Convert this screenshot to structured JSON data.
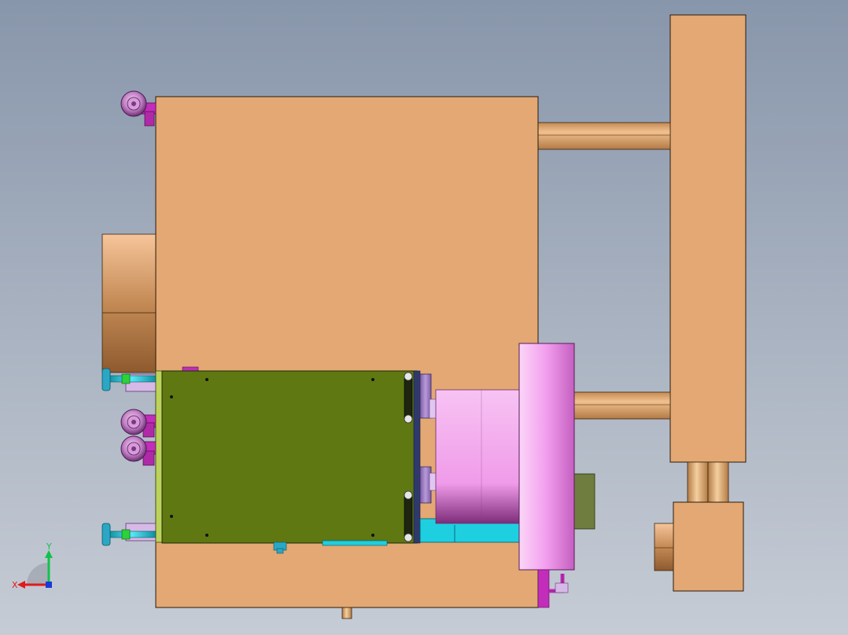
{
  "viewport": {
    "background_top": "#8896ab",
    "background_bottom": "#c6ccd5"
  },
  "model": {
    "part_colors": {
      "mold_plate": "#e3a873",
      "tie_rod": "#d9a26c",
      "green_block": "#5f7812",
      "pink_cylinder": "#f2a6f0",
      "violet_cylinder": "#a989c9",
      "cyan_piping": "#1ecfe0",
      "magenta_fitting": "#c22dba",
      "olive_box": "#6f7d3e"
    },
    "note": ""
  },
  "triad": {
    "x_label": "X",
    "y_label": "Y",
    "x_color": "#e01b1b",
    "y_color": "#13c24a",
    "z_color": "#1a3ad6"
  }
}
